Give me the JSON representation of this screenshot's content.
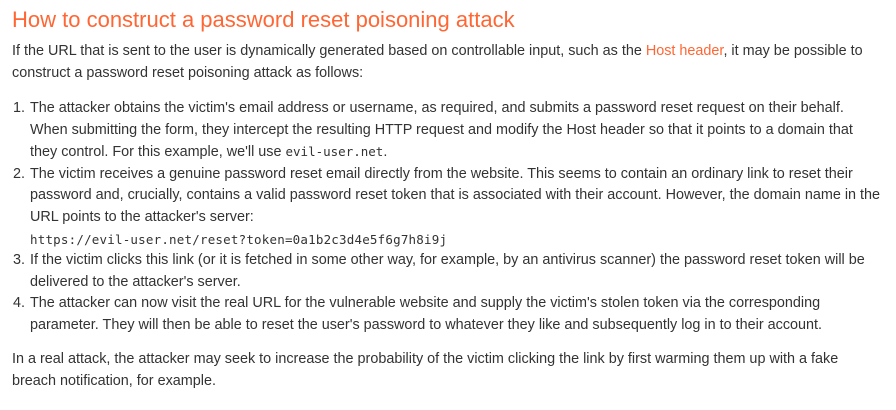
{
  "heading": "How to construct a password reset poisoning attack",
  "intro": {
    "before_link": "If the URL that is sent to the user is dynamically generated based on controllable input, such as the ",
    "link_text": "Host header",
    "after_link": ", it may be possible to construct a password reset poisoning attack as follows:"
  },
  "steps": [
    {
      "text": "The attacker obtains the victim's email address or username, as required, and submits a password reset request on their behalf. When submitting the form, they intercept the resulting HTTP request and modify the Host header so that it points to a domain that they control. For this example, we'll use ",
      "code": "evil-user.net",
      "after": "."
    },
    {
      "text": "The victim receives a genuine password reset email directly from the website. This seems to contain an ordinary link to reset their password and, crucially, contains a valid password reset token that is associated with their account. However, the domain name in the URL points to the attacker's server:",
      "code_block": "https://evil-user.net/reset?token=0a1b2c3d4e5f6g7h8i9j"
    },
    {
      "text": "If the victim clicks this link (or it is fetched in some other way, for example, by an antivirus scanner) the password reset token will be delivered to the attacker's server."
    },
    {
      "text": "The attacker can now visit the real URL for the vulnerable website and supply the victim's stolen token via the corresponding parameter. They will then be able to reset the user's password to whatever they like and subsequently log in to their account."
    }
  ],
  "outro": "In a real attack, the attacker may seek to increase the probability of the victim clicking the link by first warming them up with a fake breach notification, for example.",
  "colors": {
    "heading": "#ff6633",
    "link": "#ff6633",
    "text": "#333333"
  }
}
